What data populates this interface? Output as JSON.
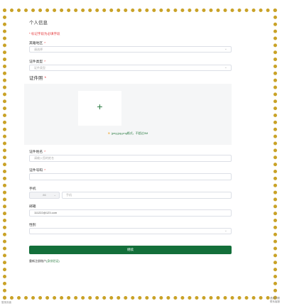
{
  "form": {
    "title": "个人信息",
    "required_note": "* 标记字段为必填字段",
    "region": {
      "label": "其籍地区",
      "placeholder": "请选择"
    },
    "id_type": {
      "label": "证件类型",
      "placeholder": "证件类型"
    },
    "certificate": {
      "label": "证件照",
      "plus": "+",
      "hint": "jpeg,jpg,png格式，不超过5M",
      "warn_symbol": "⊕"
    },
    "name": {
      "label": "证件姓名",
      "placeholder": "请输入您的姓名"
    },
    "id_number": {
      "label": "证件号码",
      "placeholder": ""
    },
    "phone": {
      "label": "手机",
      "prefix": "86",
      "placeholder": "手机"
    },
    "email": {
      "label": "邮箱",
      "value": "111222@123.com"
    },
    "gender": {
      "label": "性别",
      "placeholder": ""
    },
    "submit_label": "继续",
    "register_text": "重新注册账户",
    "register_link": "(身份验证)",
    "required_mark": "*",
    "chevron": "⌄"
  },
  "corners": {
    "left": "登录页面",
    "right_line1": "遇到问题",
    "right_line2": "联系客服"
  },
  "colors": {
    "accent": "#136f3a",
    "required": "#e4393c",
    "border": "#c9a227"
  }
}
